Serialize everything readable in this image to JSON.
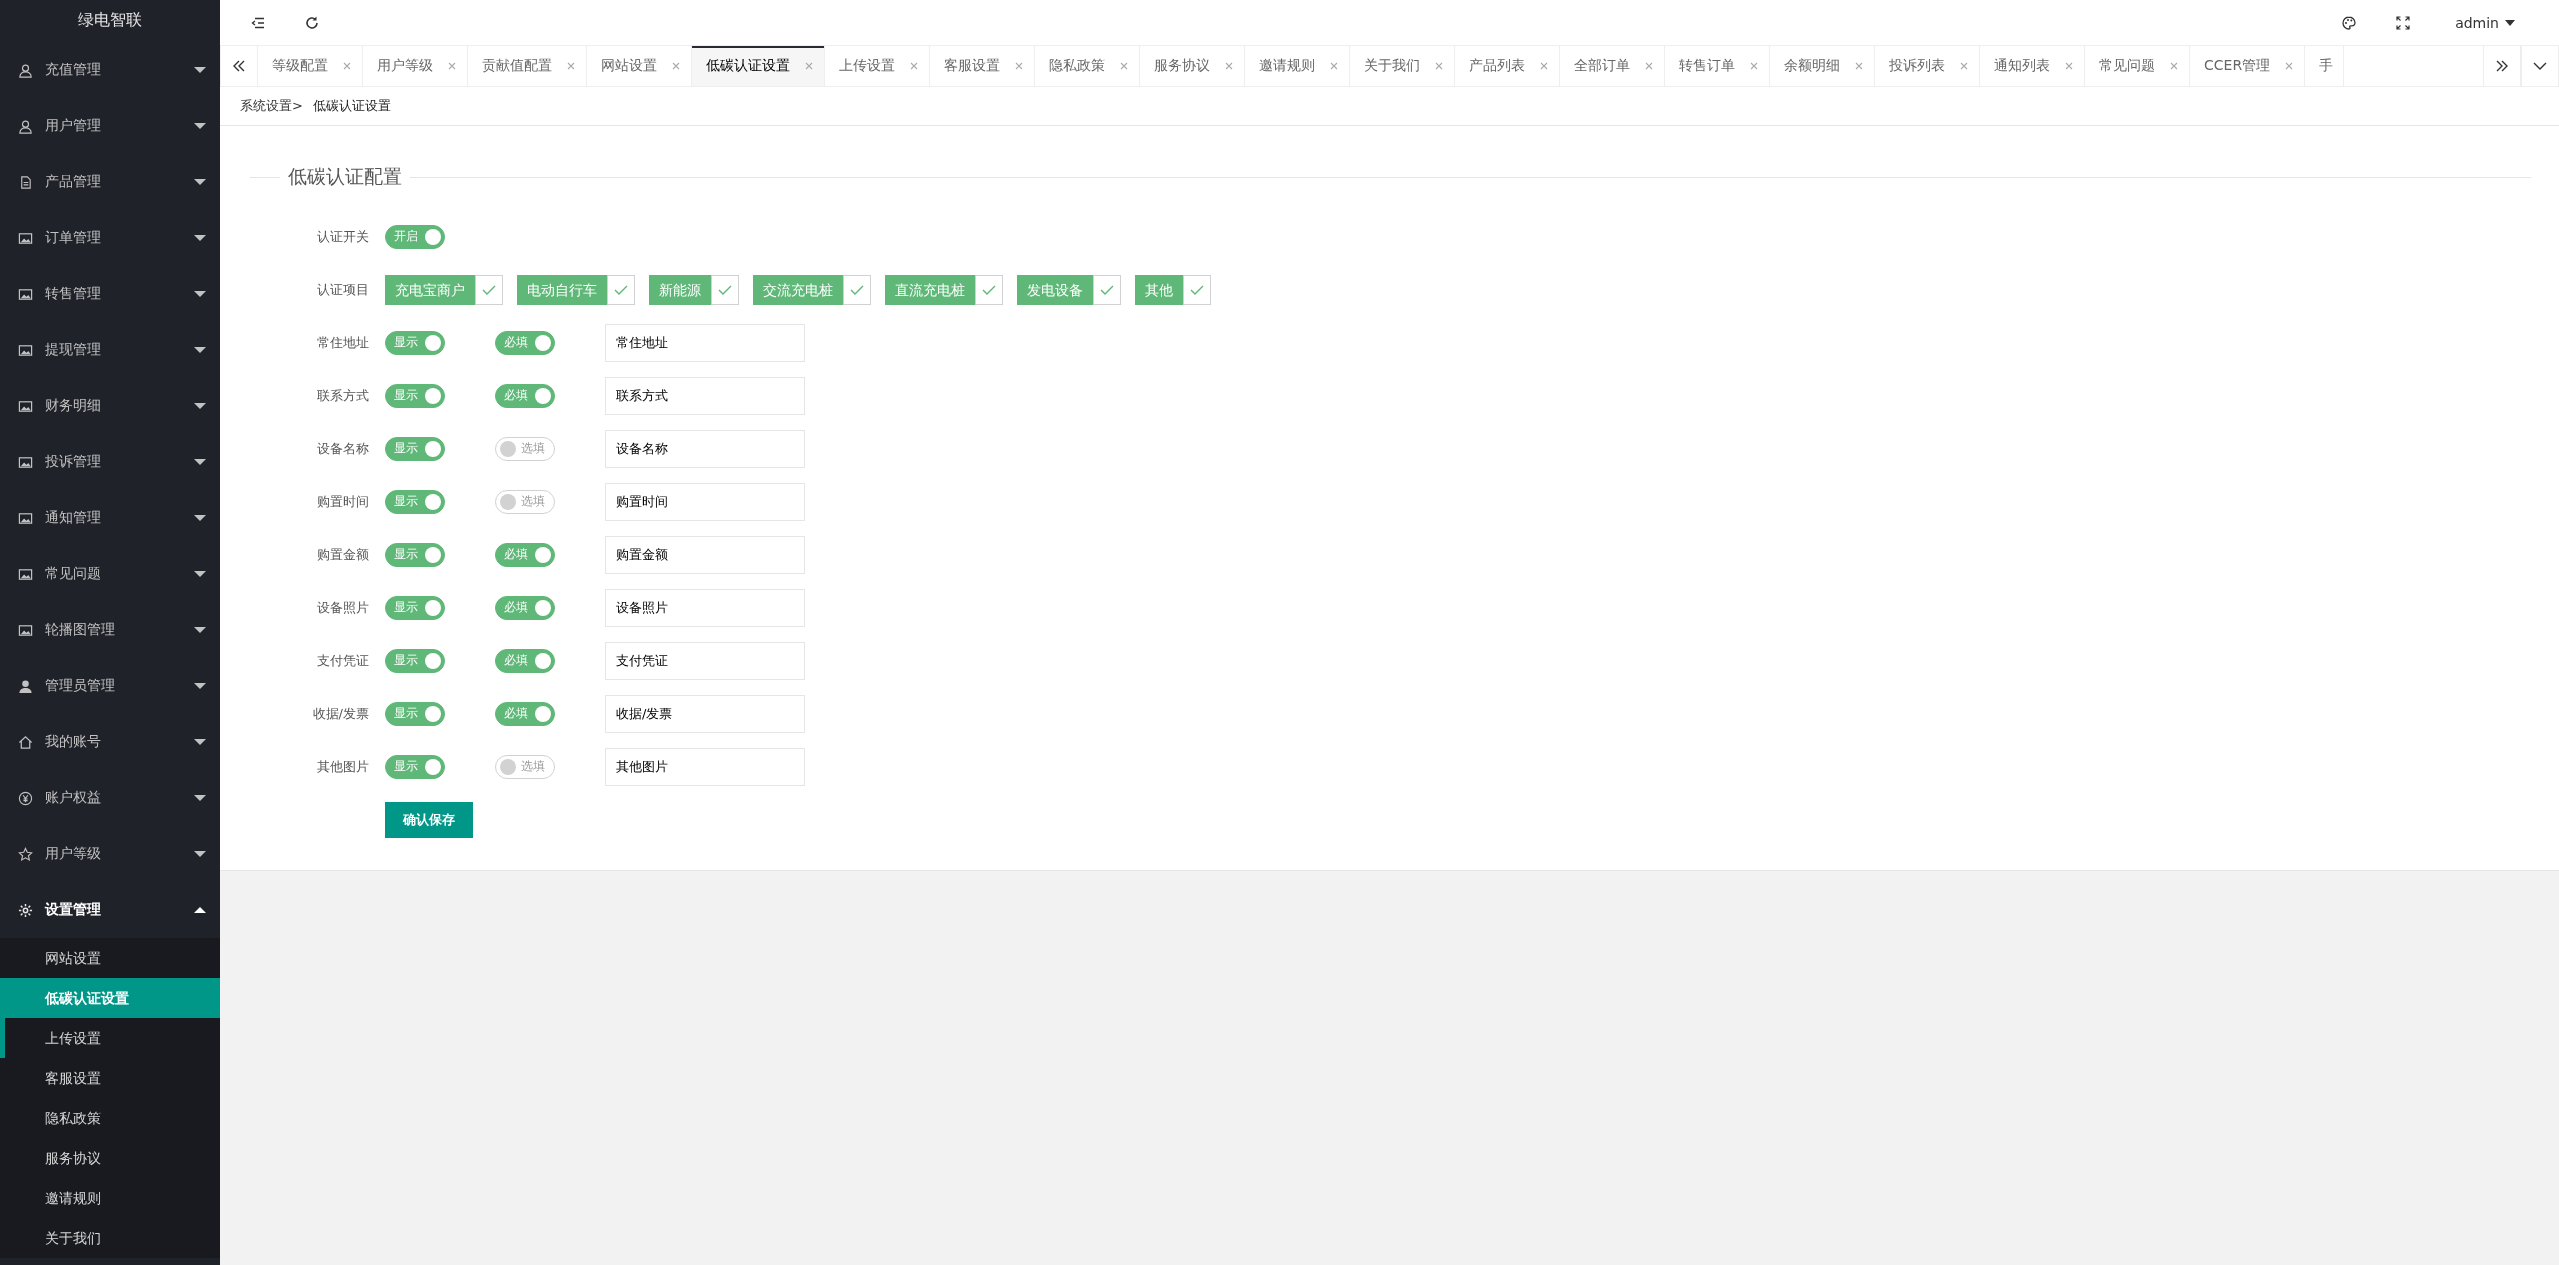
{
  "app": {
    "title": "绿电智联"
  },
  "sidebar": {
    "items": [
      {
        "label": "充值管理",
        "kind": "user",
        "expanded": false
      },
      {
        "label": "用户管理",
        "kind": "user",
        "expanded": false
      },
      {
        "label": "产品管理",
        "kind": "doc",
        "expanded": false
      },
      {
        "label": "订单管理",
        "kind": "image",
        "expanded": false
      },
      {
        "label": "转售管理",
        "kind": "image",
        "expanded": false
      },
      {
        "label": "提现管理",
        "kind": "image",
        "expanded": false
      },
      {
        "label": "财务明细",
        "kind": "image",
        "expanded": false
      },
      {
        "label": "投诉管理",
        "kind": "image",
        "expanded": false
      },
      {
        "label": "通知管理",
        "kind": "image",
        "expanded": false
      },
      {
        "label": "常见问题",
        "kind": "image",
        "expanded": false
      },
      {
        "label": "轮播图管理",
        "kind": "image",
        "expanded": false
      },
      {
        "label": "管理员管理",
        "kind": "person",
        "expanded": false
      },
      {
        "label": "我的账号",
        "kind": "home",
        "expanded": false
      },
      {
        "label": "账户权益",
        "kind": "yen",
        "expanded": false
      },
      {
        "label": "用户等级",
        "kind": "star",
        "expanded": false
      },
      {
        "label": "设置管理",
        "kind": "gear",
        "expanded": true,
        "children": [
          {
            "label": "网站设置",
            "selected": false,
            "hovered": false
          },
          {
            "label": "低碳认证设置",
            "selected": true,
            "hovered": false
          },
          {
            "label": "上传设置",
            "selected": false,
            "hovered": true
          },
          {
            "label": "客服设置",
            "selected": false,
            "hovered": false
          },
          {
            "label": "隐私政策",
            "selected": false,
            "hovered": false
          },
          {
            "label": "服务协议",
            "selected": false,
            "hovered": false
          },
          {
            "label": "邀请规则",
            "selected": false,
            "hovered": false
          },
          {
            "label": "关于我们",
            "selected": false,
            "hovered": false
          }
        ]
      }
    ]
  },
  "header": {
    "user": "admin"
  },
  "tabs": [
    {
      "label": "等级配置",
      "selected": false,
      "closable": true
    },
    {
      "label": "用户等级",
      "selected": false,
      "closable": true
    },
    {
      "label": "贡献值配置",
      "selected": false,
      "closable": true
    },
    {
      "label": "网站设置",
      "selected": false,
      "closable": true
    },
    {
      "label": "低碳认证设置",
      "selected": true,
      "closable": true
    },
    {
      "label": "上传设置",
      "selected": false,
      "closable": true
    },
    {
      "label": "客服设置",
      "selected": false,
      "closable": true
    },
    {
      "label": "隐私政策",
      "selected": false,
      "closable": true
    },
    {
      "label": "服务协议",
      "selected": false,
      "closable": true
    },
    {
      "label": "邀请规则",
      "selected": false,
      "closable": true
    },
    {
      "label": "关于我们",
      "selected": false,
      "closable": true
    },
    {
      "label": "产品列表",
      "selected": false,
      "closable": true
    },
    {
      "label": "全部订单",
      "selected": false,
      "closable": true
    },
    {
      "label": "转售订单",
      "selected": false,
      "closable": true
    },
    {
      "label": "余额明细",
      "selected": false,
      "closable": true
    },
    {
      "label": "投诉列表",
      "selected": false,
      "closable": true
    },
    {
      "label": "通知列表",
      "selected": false,
      "closable": true
    },
    {
      "label": "常见问题",
      "selected": false,
      "closable": true
    },
    {
      "label": "CCER管理",
      "selected": false,
      "closable": true
    },
    {
      "label": "手",
      "selected": false,
      "closable": false
    }
  ],
  "breadcrumb": [
    "系统设置>",
    "低碳认证设置"
  ],
  "form": {
    "legend": "低碳认证配置",
    "switch": {
      "label": "认证开关",
      "text": "开启",
      "on": true
    },
    "projects": {
      "label": "认证项目",
      "items": [
        {
          "label": "充电宝商户",
          "checked": true
        },
        {
          "label": "电动自行车",
          "checked": true
        },
        {
          "label": "新能源",
          "checked": true
        },
        {
          "label": "交流充电桩",
          "checked": true
        },
        {
          "label": "直流充电桩",
          "checked": true
        },
        {
          "label": "发电设备",
          "checked": true
        },
        {
          "label": "其他",
          "checked": true
        }
      ]
    },
    "fields": [
      {
        "label": "常住地址",
        "show": {
          "text": "显示",
          "on": true
        },
        "required": {
          "text": "必填",
          "on": true
        },
        "value": "常住地址"
      },
      {
        "label": "联系方式",
        "show": {
          "text": "显示",
          "on": true
        },
        "required": {
          "text": "必填",
          "on": true
        },
        "value": "联系方式"
      },
      {
        "label": "设备名称",
        "show": {
          "text": "显示",
          "on": true
        },
        "required": {
          "text": "选填",
          "on": false
        },
        "value": "设备名称"
      },
      {
        "label": "购置时间",
        "show": {
          "text": "显示",
          "on": true
        },
        "required": {
          "text": "选填",
          "on": false
        },
        "value": "购置时间"
      },
      {
        "label": "购置金额",
        "show": {
          "text": "显示",
          "on": true
        },
        "required": {
          "text": "必填",
          "on": true
        },
        "value": "购置金额"
      },
      {
        "label": "设备照片",
        "show": {
          "text": "显示",
          "on": true
        },
        "required": {
          "text": "必填",
          "on": true
        },
        "value": "设备照片"
      },
      {
        "label": "支付凭证",
        "show": {
          "text": "显示",
          "on": true
        },
        "required": {
          "text": "必填",
          "on": true
        },
        "value": "支付凭证"
      },
      {
        "label": "收据/发票",
        "show": {
          "text": "显示",
          "on": true
        },
        "required": {
          "text": "必填",
          "on": true
        },
        "value": "收据/发票"
      },
      {
        "label": "其他图片",
        "show": {
          "text": "显示",
          "on": true
        },
        "required": {
          "text": "选填",
          "on": false
        },
        "value": "其他图片"
      }
    ],
    "submit": "确认保存"
  }
}
